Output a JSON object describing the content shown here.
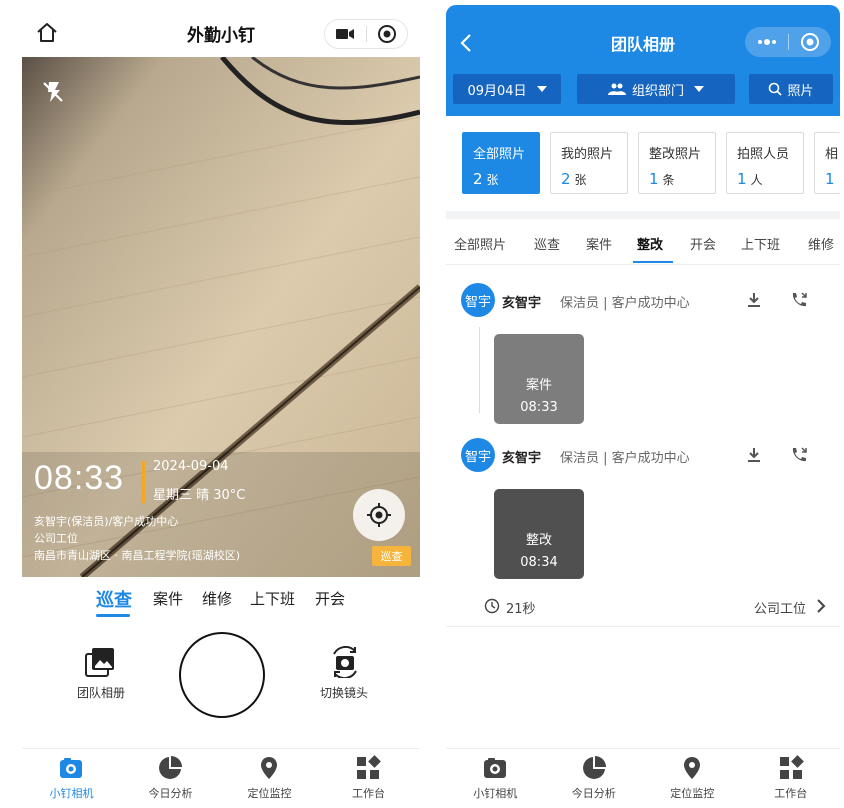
{
  "left": {
    "title": "外勤小钉",
    "watermark": {
      "time": "08:33",
      "date": "2024-09-04",
      "weather": "星期三 晴 30°C",
      "person": "亥智宇(保洁员)/客户成功中心",
      "place": "公司工位",
      "address": "南昌市青山湖区 · 南昌工程学院(瑶湖校区)",
      "tag": "巡查"
    },
    "modes": [
      "巡查",
      "案件",
      "维修",
      "上下班",
      "开会"
    ],
    "active_mode": "巡查",
    "team_album_label": "团队相册",
    "switch_camera_label": "切换镜头",
    "tabbar": [
      "小钉相机",
      "今日分析",
      "定位监控",
      "工作台"
    ],
    "active_tab": "小钉相机"
  },
  "right": {
    "title": "团队相册",
    "filters": {
      "date": "09月04日",
      "dept": "组织部门",
      "photo": "照片"
    },
    "stats": [
      {
        "title": "全部照片",
        "count": "2",
        "unit": "张"
      },
      {
        "title": "我的照片",
        "count": "2",
        "unit": "张"
      },
      {
        "title": "整改照片",
        "count": "1",
        "unit": "条"
      },
      {
        "title": "拍照人员",
        "count": "1",
        "unit": "人"
      },
      {
        "title": "相",
        "count": "1",
        "unit": ""
      }
    ],
    "tabs": [
      "全部照片",
      "巡查",
      "案件",
      "整改",
      "开会",
      "上下班",
      "维修"
    ],
    "active_tab": "整改",
    "posts": [
      {
        "avatar": "智宇",
        "name": "亥智宇",
        "role": "保洁员 | 客户成功中心",
        "photo_type": "案件",
        "photo_time": "08:33"
      },
      {
        "avatar": "智宇",
        "name": "亥智宇",
        "role": "保洁员 | 客户成功中心",
        "photo_type": "整改",
        "photo_time": "08:34"
      }
    ],
    "duration": "21秒",
    "location": "公司工位",
    "tabbar": [
      "小钉相机",
      "今日分析",
      "定位监控",
      "工作台"
    ]
  },
  "colors": {
    "accent": "#1e88e5",
    "dark_accent": "#1565c0",
    "tag": "#f5b53c"
  }
}
